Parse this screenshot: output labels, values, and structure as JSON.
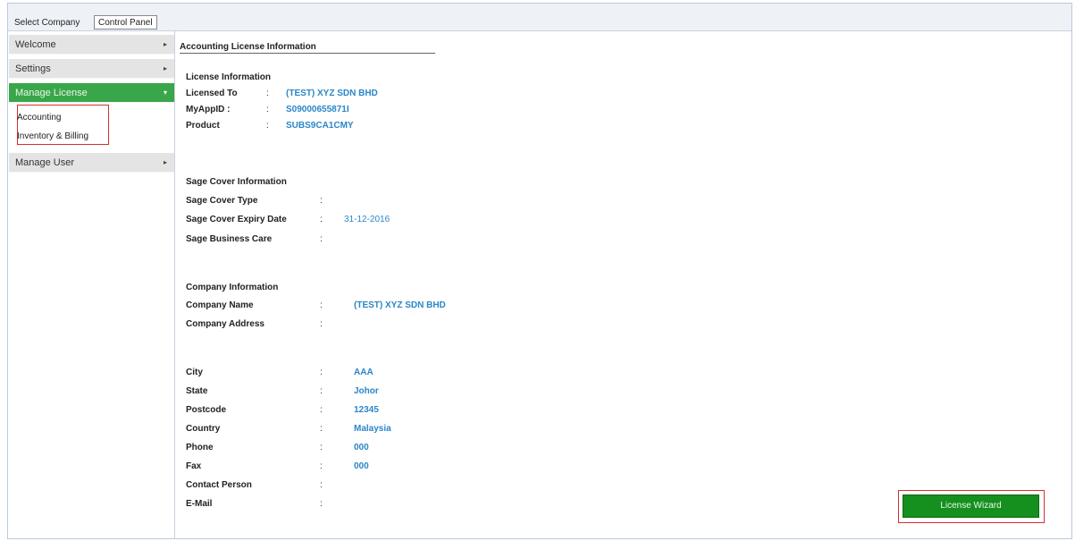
{
  "tabs": {
    "select_company": "Select Company",
    "control_panel": "Control Panel"
  },
  "sidebar": {
    "items": [
      {
        "label": "Welcome",
        "arrow": "▸"
      },
      {
        "label": "Settings",
        "arrow": "▸"
      },
      {
        "label": "Manage License",
        "arrow": "▾"
      },
      {
        "label": "Manage User",
        "arrow": "▸"
      }
    ],
    "subitems": [
      {
        "label": "Accounting"
      },
      {
        "label": "Inventory & Billing"
      }
    ]
  },
  "main": {
    "title": "Accounting License Information",
    "colon": ":",
    "license": {
      "heading": "License Information",
      "licensed_to_label": "Licensed To",
      "licensed_to_value": "(TEST) XYZ SDN BHD",
      "myappid_label": "MyAppID :",
      "myappid_value": "S09000655871I",
      "product_label": "Product",
      "product_value": "SUBS9CA1CMY"
    },
    "sage": {
      "heading": "Sage Cover Information",
      "type_label": "Sage Cover Type",
      "type_value": "",
      "expiry_label": "Sage Cover Expiry Date",
      "expiry_value": "31-12-2016",
      "business_care_label": "Sage Business Care",
      "business_care_value": ""
    },
    "company": {
      "heading": "Company Information",
      "name_label": "Company Name",
      "name_value": "(TEST) XYZ SDN BHD",
      "address_label": "Company Address",
      "address_value": "",
      "city_label": "City",
      "city_value": "AAA",
      "state_label": "State",
      "state_value": "Johor",
      "postcode_label": "Postcode",
      "postcode_value": "12345",
      "country_label": "Country",
      "country_value": "Malaysia",
      "phone_label": "Phone",
      "phone_value": "000",
      "fax_label": "Fax",
      "fax_value": "000",
      "contact_label": "Contact Person",
      "contact_value": "",
      "email_label": "E-Mail",
      "email_value": ""
    },
    "wizard_button": "License Wizard"
  },
  "colors": {
    "accent_green": "#3aa64a",
    "button_green": "#158f1e",
    "value_blue": "#2a86c8",
    "highlight_red": "#d0312d"
  }
}
